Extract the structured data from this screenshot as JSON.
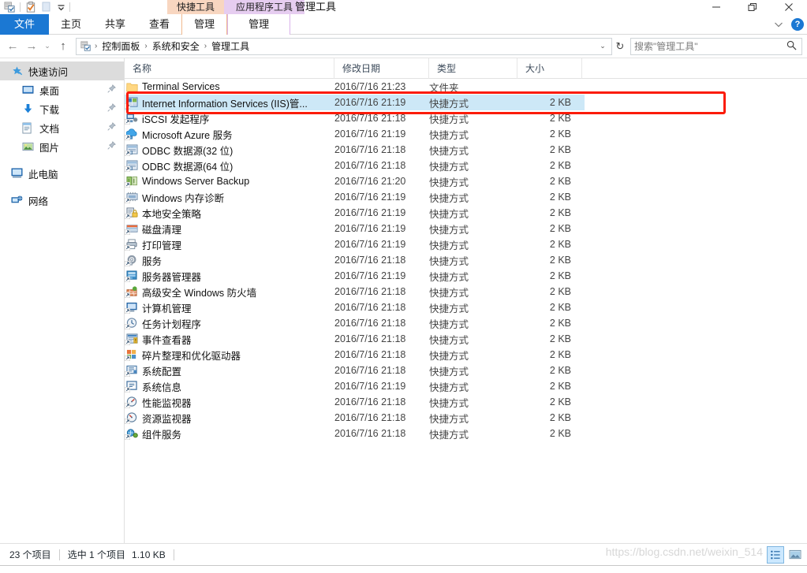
{
  "window": {
    "title": "管理工具",
    "quick_access": [
      {
        "name": "folder-tools-icon",
        "label": "管理工具"
      },
      {
        "name": "properties-icon",
        "label": "属性"
      },
      {
        "name": "new-folder-icon",
        "label": "新建文件夹"
      },
      {
        "name": "customize-dropdown-icon",
        "label": "自定义快速访问工具栏"
      }
    ],
    "controls": {
      "minimize": "—",
      "restore": "❐",
      "close": "✕",
      "ribbon_collapse": "⌄",
      "help": "?"
    }
  },
  "ribbon": {
    "contextual_headers": [
      {
        "label": "快捷工具",
        "color": "#f8d6c0"
      },
      {
        "label": "应用程序工具",
        "color": "#e6cdf0"
      }
    ],
    "tabs": [
      {
        "label": "文件",
        "active": true
      },
      {
        "label": "主页",
        "active": false
      },
      {
        "label": "共享",
        "active": false
      },
      {
        "label": "查看",
        "active": false
      },
      {
        "label": "管理",
        "active": false,
        "context": "shortcut"
      },
      {
        "label": "管理",
        "active": false,
        "context": "app"
      }
    ]
  },
  "navigation": {
    "back": "←",
    "forward": "→",
    "recent": "⌄",
    "up": "↑",
    "refresh": "↻",
    "breadcrumb": [
      "控制面板",
      "系统和安全",
      "管理工具"
    ],
    "breadcrumb_sep": "›",
    "breadcrumb_caret": "⌄"
  },
  "search": {
    "placeholder": "搜索\"管理工具\"",
    "value": "",
    "icon": "search-icon"
  },
  "sidebar": {
    "items": [
      {
        "label": "快速访问",
        "icon": "star-pin-icon",
        "selected": true,
        "indent": false,
        "pinned": false
      },
      {
        "label": "桌面",
        "icon": "desktop-icon",
        "selected": false,
        "indent": true,
        "pinned": true
      },
      {
        "label": "下载",
        "icon": "download-icon",
        "selected": false,
        "indent": true,
        "pinned": true
      },
      {
        "label": "文档",
        "icon": "documents-icon",
        "selected": false,
        "indent": true,
        "pinned": true
      },
      {
        "label": "图片",
        "icon": "pictures-icon",
        "selected": false,
        "indent": true,
        "pinned": true
      },
      {
        "label": "此电脑",
        "icon": "this-pc-icon",
        "selected": false,
        "indent": false,
        "pinned": false,
        "gap": true
      },
      {
        "label": "网络",
        "icon": "network-icon",
        "selected": false,
        "indent": false,
        "pinned": false,
        "gap": true
      }
    ]
  },
  "file_list": {
    "columns": [
      "名称",
      "修改日期",
      "类型",
      "大小"
    ],
    "rows": [
      {
        "name": "Terminal Services",
        "date": "2016/7/16 21:23",
        "type": "文件夹",
        "size": "",
        "icon": "folder-icon",
        "selected": false
      },
      {
        "name": "Internet Information Services (IIS)管...",
        "date": "2016/7/16 21:19",
        "type": "快捷方式",
        "size": "2 KB",
        "icon": "iis-manager-icon",
        "selected": true
      },
      {
        "name": "iSCSI 发起程序",
        "date": "2016/7/16 21:18",
        "type": "快捷方式",
        "size": "2 KB",
        "icon": "iscsi-icon",
        "selected": false
      },
      {
        "name": "Microsoft Azure 服务",
        "date": "2016/7/16 21:19",
        "type": "快捷方式",
        "size": "2 KB",
        "icon": "azure-icon",
        "selected": false
      },
      {
        "name": "ODBC 数据源(32 位)",
        "date": "2016/7/16 21:18",
        "type": "快捷方式",
        "size": "2 KB",
        "icon": "odbc-icon",
        "selected": false
      },
      {
        "name": "ODBC 数据源(64 位)",
        "date": "2016/7/16 21:18",
        "type": "快捷方式",
        "size": "2 KB",
        "icon": "odbc-icon",
        "selected": false
      },
      {
        "name": "Windows Server Backup",
        "date": "2016/7/16 21:20",
        "type": "快捷方式",
        "size": "2 KB",
        "icon": "backup-icon",
        "selected": false
      },
      {
        "name": "Windows 内存诊断",
        "date": "2016/7/16 21:19",
        "type": "快捷方式",
        "size": "2 KB",
        "icon": "memory-diagnostic-icon",
        "selected": false
      },
      {
        "name": "本地安全策略",
        "date": "2016/7/16 21:19",
        "type": "快捷方式",
        "size": "2 KB",
        "icon": "local-security-policy-icon",
        "selected": false
      },
      {
        "name": "磁盘清理",
        "date": "2016/7/16 21:19",
        "type": "快捷方式",
        "size": "2 KB",
        "icon": "disk-cleanup-icon",
        "selected": false
      },
      {
        "name": "打印管理",
        "date": "2016/7/16 21:19",
        "type": "快捷方式",
        "size": "2 KB",
        "icon": "print-management-icon",
        "selected": false
      },
      {
        "name": "服务",
        "date": "2016/7/16 21:18",
        "type": "快捷方式",
        "size": "2 KB",
        "icon": "services-icon",
        "selected": false
      },
      {
        "name": "服务器管理器",
        "date": "2016/7/16 21:19",
        "type": "快捷方式",
        "size": "2 KB",
        "icon": "server-manager-icon",
        "selected": false
      },
      {
        "name": "高级安全 Windows 防火墙",
        "date": "2016/7/16 21:18",
        "type": "快捷方式",
        "size": "2 KB",
        "icon": "firewall-icon",
        "selected": false
      },
      {
        "name": "计算机管理",
        "date": "2016/7/16 21:18",
        "type": "快捷方式",
        "size": "2 KB",
        "icon": "computer-management-icon",
        "selected": false
      },
      {
        "name": "任务计划程序",
        "date": "2016/7/16 21:18",
        "type": "快捷方式",
        "size": "2 KB",
        "icon": "task-scheduler-icon",
        "selected": false
      },
      {
        "name": "事件查看器",
        "date": "2016/7/16 21:18",
        "type": "快捷方式",
        "size": "2 KB",
        "icon": "event-viewer-icon",
        "selected": false
      },
      {
        "name": "碎片整理和优化驱动器",
        "date": "2016/7/16 21:18",
        "type": "快捷方式",
        "size": "2 KB",
        "icon": "defragment-icon",
        "selected": false
      },
      {
        "name": "系统配置",
        "date": "2016/7/16 21:18",
        "type": "快捷方式",
        "size": "2 KB",
        "icon": "system-config-icon",
        "selected": false
      },
      {
        "name": "系统信息",
        "date": "2016/7/16 21:19",
        "type": "快捷方式",
        "size": "2 KB",
        "icon": "system-info-icon",
        "selected": false
      },
      {
        "name": "性能监视器",
        "date": "2016/7/16 21:18",
        "type": "快捷方式",
        "size": "2 KB",
        "icon": "performance-monitor-icon",
        "selected": false
      },
      {
        "name": "资源监视器",
        "date": "2016/7/16 21:18",
        "type": "快捷方式",
        "size": "2 KB",
        "icon": "resource-monitor-icon",
        "selected": false
      },
      {
        "name": "组件服务",
        "date": "2016/7/16 21:18",
        "type": "快捷方式",
        "size": "2 KB",
        "icon": "component-services-icon",
        "selected": false
      }
    ]
  },
  "annotation": {
    "color": "#fb1b08",
    "target_row_index": 1
  },
  "status": {
    "item_count": "23 个项目",
    "selection": "选中 1 个项目",
    "selection_size": "1.10 KB",
    "watermark": "https://blog.csdn.net/weixin_514",
    "view_buttons": [
      {
        "name": "details-view-icon",
        "active": true
      },
      {
        "name": "large-icons-view-icon",
        "active": false
      }
    ]
  }
}
